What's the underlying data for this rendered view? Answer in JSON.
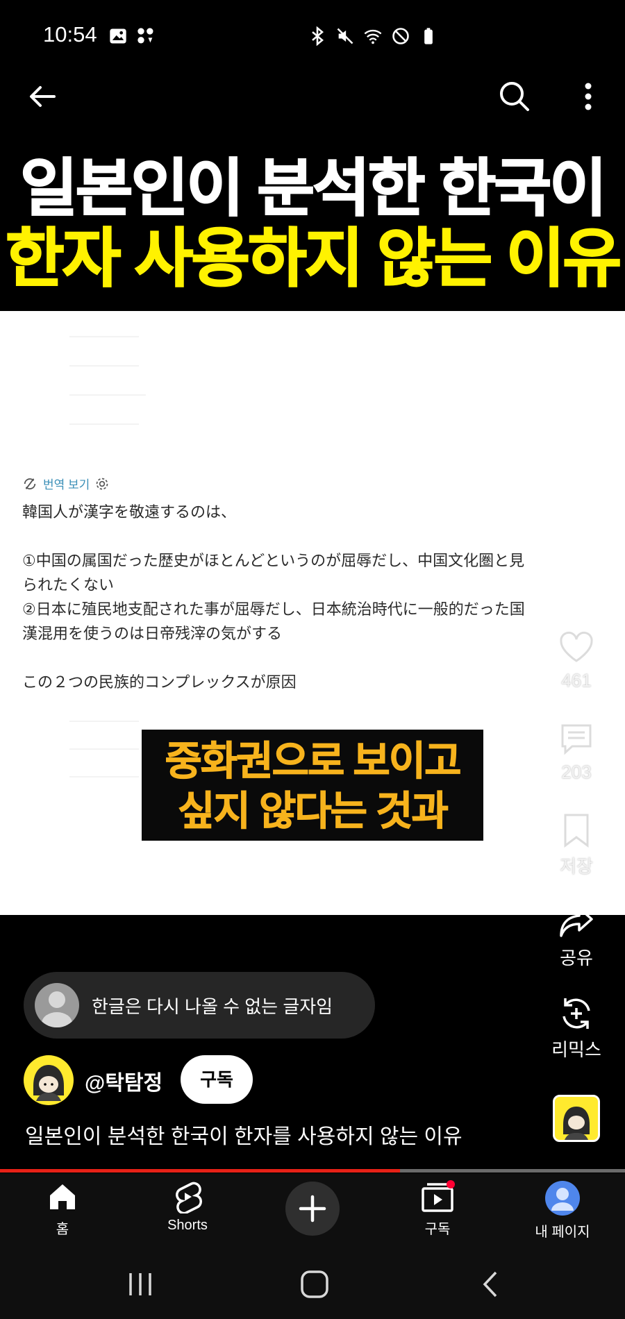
{
  "status_bar": {
    "time": "10:54",
    "left_icons": [
      "gallery-icon",
      "notification-dots-icon"
    ],
    "right_icons": [
      "bluetooth-icon",
      "mute-icon",
      "wifi-icon",
      "do-not-disturb-icon",
      "battery-icon"
    ]
  },
  "top_bar": {
    "icons": [
      "back-arrow-icon",
      "search-icon",
      "more-vert-icon"
    ]
  },
  "video": {
    "title_line1": "일본인이 분석한 한국이",
    "title_line2": "한자 사용하지 않는 이유",
    "translate_label": "번역 보기",
    "post_lines": [
      "韓国人が漢字を敬遠するのは、",
      "①中国の属国だった歴史がほとんどというのが屈辱だし、中国文化圏と見",
      "られたくない",
      "②日本に殖民地支配された事が屈辱だし、日本統治時代に一般的だった国",
      "漢混用を使うのは日帝残滓の気がする",
      "この２つの民族的コンプレックスが原因"
    ],
    "caption_line1": "중화권으로 보이고",
    "caption_line2": "싶지 않다는 것과",
    "colors": {
      "title_white": "#ffffff",
      "title_yellow": "#fff200",
      "caption": "#f7b31d"
    }
  },
  "actions": {
    "like_count": "461",
    "comment_count": "203",
    "save_label": "저장",
    "share_label": "공유",
    "remix_label": "리믹스"
  },
  "comment_preview": {
    "text": "한글은 다시 나올 수 없는 글자임"
  },
  "channel": {
    "handle": "@탁탐정",
    "subscribe_label": "구독"
  },
  "video_description": "일본인이 분석한 한국이 한자를 사용하지 않는 이유",
  "progress": {
    "fraction": 0.64,
    "color": "#e62117"
  },
  "bottom_nav": {
    "home": "홈",
    "shorts": "Shorts",
    "subscriptions": "구독",
    "my_page": "내 페이지"
  },
  "system_nav": {
    "icons": [
      "recents-icon",
      "home-icon",
      "back-icon"
    ]
  }
}
